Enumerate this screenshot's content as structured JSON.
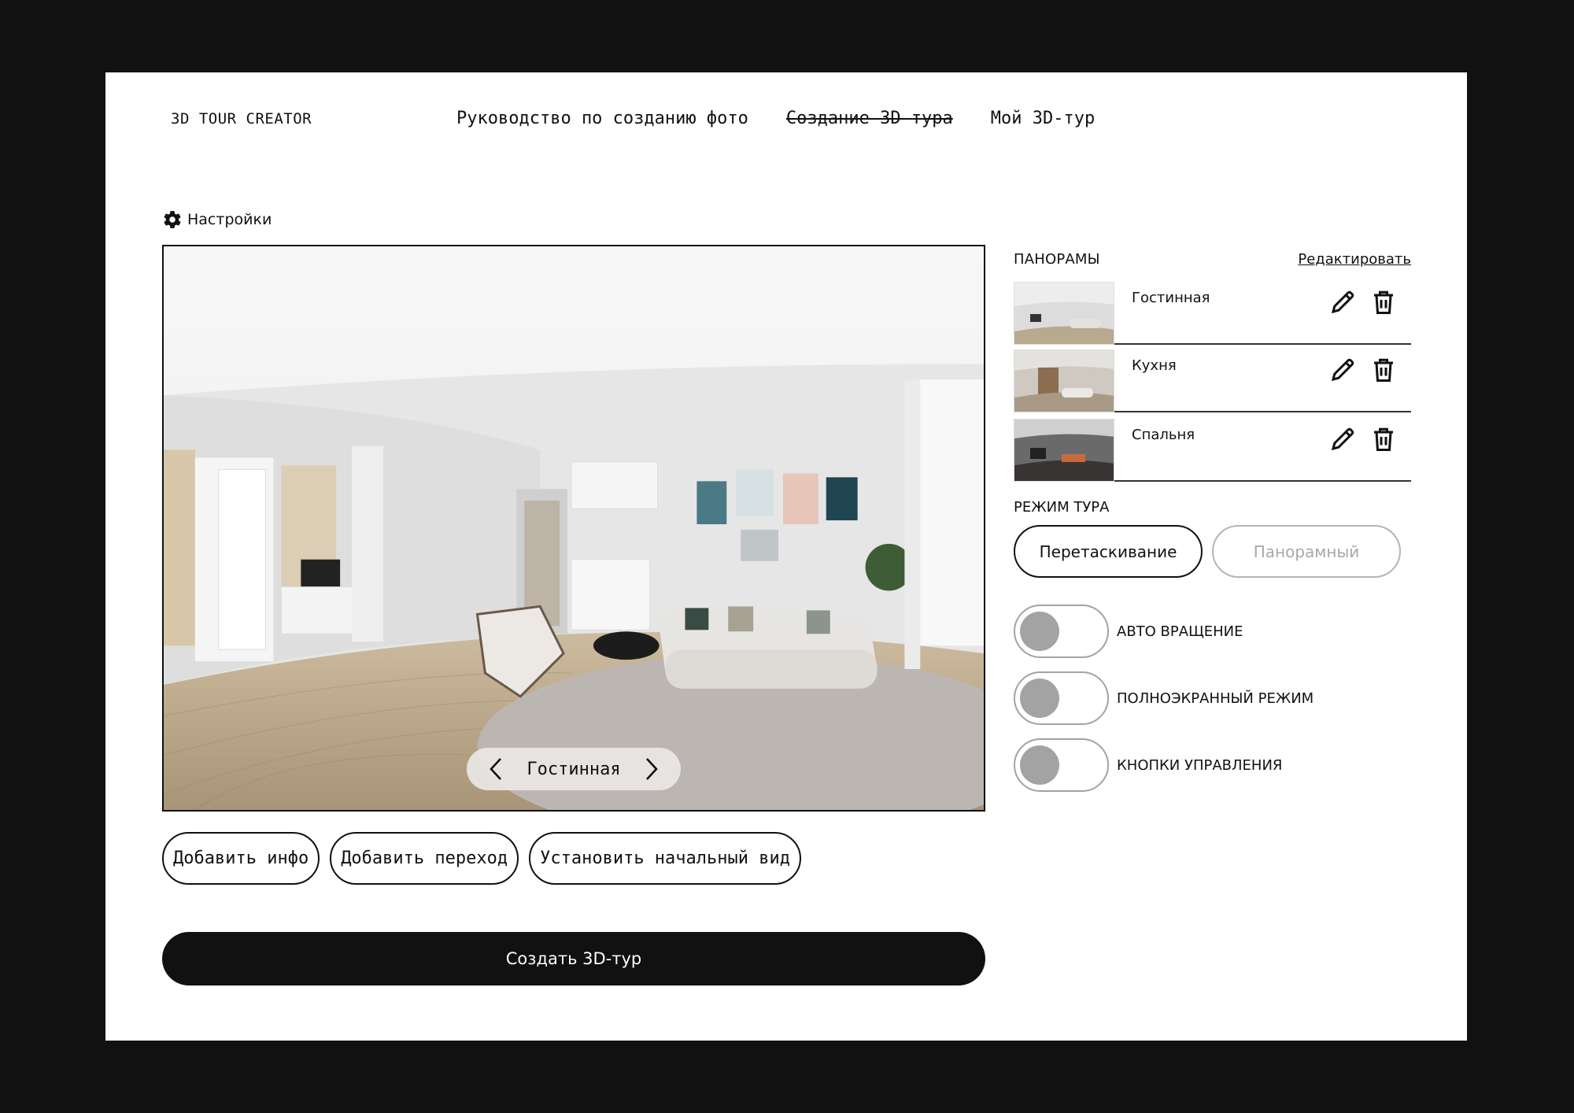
{
  "header": {
    "logo": "3D TOUR CREATOR",
    "nav": [
      {
        "label": "Руководство по созданию фото"
      },
      {
        "label": "Создание 3D-тура"
      },
      {
        "label": "Мой 3D-тур"
      }
    ]
  },
  "settings": {
    "label": "Настройки"
  },
  "viewer": {
    "current_panorama": "Гостинная"
  },
  "tools": {
    "add_info": "Добавить инфо",
    "add_transition": "Добавить переход",
    "set_start_view": "Установить начальный вид"
  },
  "create_button": "Создать 3D-тур",
  "panoramas": {
    "title": "ПАНОРАМЫ",
    "edit_link": "Редактировать",
    "items": [
      {
        "name": "Гостинная"
      },
      {
        "name": "Кухня"
      },
      {
        "name": "Спальня"
      }
    ]
  },
  "tour_mode": {
    "title": "РЕЖИМ ТУРА",
    "options": [
      "Перетаскивание",
      "Панорамный"
    ],
    "selected": "Перетаскивание"
  },
  "toggles": [
    {
      "label": "АВТО ВРАЩЕНИЕ",
      "on": false
    },
    {
      "label": "ПОЛНОЭКРАННЫЙ РЕЖИМ",
      "on": false
    },
    {
      "label": "КНОПКИ УПРАВЛЕНИЯ",
      "on": false
    }
  ],
  "colors": {
    "background": "#121112",
    "surface": "#ffffff",
    "text": "#111111",
    "toggle_off": "#a3a3a3",
    "inactive_text": "#a8a8a8"
  }
}
